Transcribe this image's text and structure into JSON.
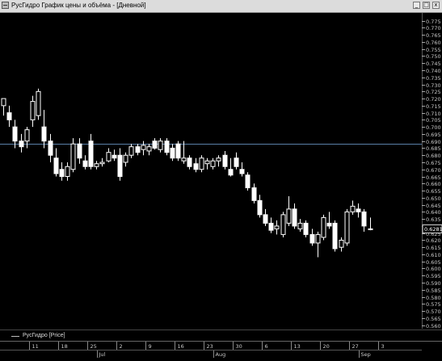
{
  "window": {
    "title": "РусГидро График цены и объёма - [Дневной]",
    "minimize_label": "_",
    "maximize_label": "□",
    "close_label": "x"
  },
  "legend": {
    "label": "РусГидро [Price]"
  },
  "chart_data": {
    "type": "candlestick",
    "ylim": [
      0.5575,
      0.7805
    ],
    "y_ticks": [
      0.56,
      0.565,
      0.57,
      0.575,
      0.58,
      0.585,
      0.59,
      0.595,
      0.6,
      0.605,
      0.61,
      0.615,
      0.62,
      0.625,
      0.63,
      0.635,
      0.64,
      0.645,
      0.65,
      0.655,
      0.66,
      0.665,
      0.67,
      0.675,
      0.68,
      0.685,
      0.69,
      0.695,
      0.7,
      0.705,
      0.71,
      0.715,
      0.72,
      0.725,
      0.73,
      0.735,
      0.74,
      0.745,
      0.75,
      0.755,
      0.76,
      0.765,
      0.77,
      0.775
    ],
    "reference_line": 0.688,
    "last_price": {
      "value": 0.628,
      "label": "0.6281"
    },
    "candles": [
      {
        "o": 0.715,
        "h": 0.72,
        "l": 0.708,
        "c": 0.72
      },
      {
        "o": 0.71,
        "h": 0.715,
        "l": 0.7,
        "c": 0.705
      },
      {
        "o": 0.7,
        "h": 0.705,
        "l": 0.685,
        "c": 0.69
      },
      {
        "o": 0.69,
        "h": 0.695,
        "l": 0.682,
        "c": 0.686
      },
      {
        "o": 0.69,
        "h": 0.7,
        "l": 0.685,
        "c": 0.698
      },
      {
        "o": 0.705,
        "h": 0.722,
        "l": 0.7,
        "c": 0.718
      },
      {
        "o": 0.708,
        "h": 0.727,
        "l": 0.705,
        "c": 0.725
      },
      {
        "o": 0.7,
        "h": 0.712,
        "l": 0.685,
        "c": 0.69
      },
      {
        "o": 0.69,
        "h": 0.695,
        "l": 0.675,
        "c": 0.68
      },
      {
        "o": 0.678,
        "h": 0.685,
        "l": 0.665,
        "c": 0.667
      },
      {
        "o": 0.67,
        "h": 0.675,
        "l": 0.662,
        "c": 0.665
      },
      {
        "o": 0.665,
        "h": 0.675,
        "l": 0.662,
        "c": 0.672
      },
      {
        "o": 0.67,
        "h": 0.692,
        "l": 0.668,
        "c": 0.688
      },
      {
        "o": 0.688,
        "h": 0.692,
        "l": 0.674,
        "c": 0.678
      },
      {
        "o": 0.676,
        "h": 0.68,
        "l": 0.67,
        "c": 0.672
      },
      {
        "o": 0.69,
        "h": 0.695,
        "l": 0.67,
        "c": 0.672
      },
      {
        "o": 0.672,
        "h": 0.676,
        "l": 0.67,
        "c": 0.674
      },
      {
        "o": 0.674,
        "h": 0.678,
        "l": 0.672,
        "c": 0.675
      },
      {
        "o": 0.676,
        "h": 0.685,
        "l": 0.675,
        "c": 0.682
      },
      {
        "o": 0.68,
        "h": 0.684,
        "l": 0.676,
        "c": 0.678
      },
      {
        "o": 0.68,
        "h": 0.685,
        "l": 0.662,
        "c": 0.665
      },
      {
        "o": 0.675,
        "h": 0.682,
        "l": 0.672,
        "c": 0.68
      },
      {
        "o": 0.68,
        "h": 0.688,
        "l": 0.678,
        "c": 0.686
      },
      {
        "o": 0.686,
        "h": 0.688,
        "l": 0.68,
        "c": 0.682
      },
      {
        "o": 0.684,
        "h": 0.69,
        "l": 0.68,
        "c": 0.687
      },
      {
        "o": 0.683,
        "h": 0.688,
        "l": 0.68,
        "c": 0.686
      },
      {
        "o": 0.69,
        "h": 0.692,
        "l": 0.684,
        "c": 0.685
      },
      {
        "o": 0.684,
        "h": 0.692,
        "l": 0.682,
        "c": 0.69
      },
      {
        "o": 0.69,
        "h": 0.692,
        "l": 0.68,
        "c": 0.682
      },
      {
        "o": 0.685,
        "h": 0.688,
        "l": 0.676,
        "c": 0.678
      },
      {
        "o": 0.688,
        "h": 0.69,
        "l": 0.676,
        "c": 0.678
      },
      {
        "o": 0.676,
        "h": 0.69,
        "l": 0.674,
        "c": 0.678
      },
      {
        "o": 0.678,
        "h": 0.68,
        "l": 0.67,
        "c": 0.672
      },
      {
        "o": 0.674,
        "h": 0.678,
        "l": 0.668,
        "c": 0.67
      },
      {
        "o": 0.67,
        "h": 0.68,
        "l": 0.668,
        "c": 0.678
      },
      {
        "o": 0.674,
        "h": 0.678,
        "l": 0.67,
        "c": 0.676
      },
      {
        "o": 0.672,
        "h": 0.678,
        "l": 0.67,
        "c": 0.676
      },
      {
        "o": 0.676,
        "h": 0.68,
        "l": 0.672,
        "c": 0.678
      },
      {
        "o": 0.68,
        "h": 0.683,
        "l": 0.67,
        "c": 0.672
      },
      {
        "o": 0.67,
        "h": 0.678,
        "l": 0.665,
        "c": 0.666
      },
      {
        "o": 0.678,
        "h": 0.682,
        "l": 0.67,
        "c": 0.672
      },
      {
        "o": 0.67,
        "h": 0.675,
        "l": 0.665,
        "c": 0.667
      },
      {
        "o": 0.666,
        "h": 0.668,
        "l": 0.655,
        "c": 0.657
      },
      {
        "o": 0.657,
        "h": 0.66,
        "l": 0.646,
        "c": 0.648
      },
      {
        "o": 0.648,
        "h": 0.652,
        "l": 0.636,
        "c": 0.638
      },
      {
        "o": 0.638,
        "h": 0.642,
        "l": 0.63,
        "c": 0.632
      },
      {
        "o": 0.632,
        "h": 0.636,
        "l": 0.625,
        "c": 0.627
      },
      {
        "o": 0.628,
        "h": 0.634,
        "l": 0.624,
        "c": 0.63
      },
      {
        "o": 0.624,
        "h": 0.64,
        "l": 0.622,
        "c": 0.638
      },
      {
        "o": 0.632,
        "h": 0.651,
        "l": 0.63,
        "c": 0.642
      },
      {
        "o": 0.642,
        "h": 0.646,
        "l": 0.628,
        "c": 0.63
      },
      {
        "o": 0.628,
        "h": 0.635,
        "l": 0.626,
        "c": 0.632
      },
      {
        "o": 0.632,
        "h": 0.634,
        "l": 0.622,
        "c": 0.624
      },
      {
        "o": 0.624,
        "h": 0.628,
        "l": 0.616,
        "c": 0.618
      },
      {
        "o": 0.618,
        "h": 0.626,
        "l": 0.608,
        "c": 0.624
      },
      {
        "o": 0.622,
        "h": 0.638,
        "l": 0.62,
        "c": 0.636
      },
      {
        "o": 0.632,
        "h": 0.64,
        "l": 0.628,
        "c": 0.63
      },
      {
        "o": 0.632,
        "h": 0.634,
        "l": 0.612,
        "c": 0.614
      },
      {
        "o": 0.615,
        "h": 0.622,
        "l": 0.612,
        "c": 0.62
      },
      {
        "o": 0.618,
        "h": 0.642,
        "l": 0.616,
        "c": 0.64
      },
      {
        "o": 0.64,
        "h": 0.648,
        "l": 0.638,
        "c": 0.644
      },
      {
        "o": 0.642,
        "h": 0.646,
        "l": 0.636,
        "c": 0.64
      },
      {
        "o": 0.64,
        "h": 0.642,
        "l": 0.626,
        "c": 0.63
      },
      {
        "o": 0.628,
        "h": 0.636,
        "l": 0.627,
        "c": 0.628
      }
    ],
    "x_day_labels": [
      "11",
      "18",
      "25",
      "2",
      "9",
      "16",
      "23",
      "30",
      "6",
      "13",
      "20",
      "27",
      "3"
    ],
    "x_month_labels": [
      "Jul",
      "Aug",
      "Sep"
    ]
  },
  "colors": {
    "background": "#000000",
    "grid": "#3a3a3a",
    "candle": "#ffffff",
    "axis_text": "#c8c8c8",
    "reference_line": "#5a7fa8"
  }
}
